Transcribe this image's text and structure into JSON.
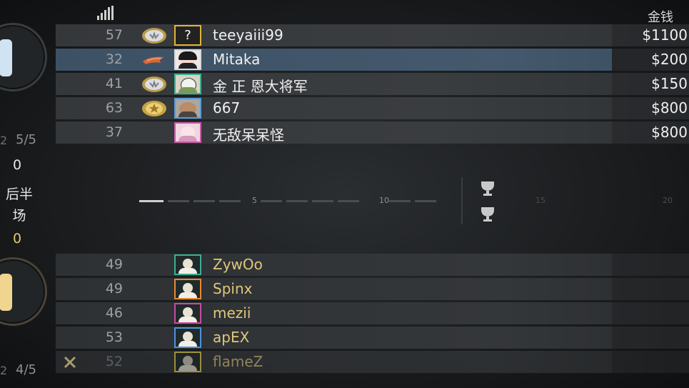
{
  "header": {
    "money_label": "金钱"
  },
  "side": {
    "t_score_ratio": "5/5",
    "t_rounds": "0",
    "half_label_1": "后半",
    "half_label_2": "场",
    "ct_rounds": "0",
    "ct_score_ratio": "4/5",
    "left_marker_top": "2",
    "left_marker_bottom": "2"
  },
  "t_team": [
    {
      "ping": "57",
      "name": "teeyaiii99",
      "money": "$1100",
      "avatar": "question-mark-avatar",
      "rank": "silver-elite-rank",
      "border": "#e0b43a"
    },
    {
      "ping": "32",
      "name": "Mitaka",
      "money": "$200",
      "avatar": "anime-girl-avatar",
      "rank": "flame-wing-rank",
      "border": "#d9d9d9"
    },
    {
      "ping": "41",
      "name": "金 正 恩大将军",
      "money": "$150",
      "avatar": "cartoon-avatar",
      "rank": "silver-elite-rank",
      "border": "#3bb08f"
    },
    {
      "ping": "63",
      "name": "667",
      "money": "$800",
      "avatar": "face-avatar",
      "rank": "gold-star-rank",
      "border": "#5b9ad8"
    },
    {
      "ping": "37",
      "name": "无敌呆呆怪",
      "money": "$800",
      "avatar": "pink-anime-avatar",
      "rank": "",
      "border": "#c85aa6"
    }
  ],
  "timeline": {
    "tick_5": "5",
    "tick_10": "10",
    "tick_15": "15",
    "tick_20": "20"
  },
  "ct_team": [
    {
      "ping": "49",
      "name": "ZywOo",
      "dead": false,
      "border": "#3bb08f"
    },
    {
      "ping": "49",
      "name": "Spinx",
      "dead": false,
      "border": "#e58a2e"
    },
    {
      "ping": "46",
      "name": "mezii",
      "dead": false,
      "border": "#c84aa0"
    },
    {
      "ping": "53",
      "name": "apEX",
      "dead": false,
      "border": "#4f90e0"
    },
    {
      "ping": "52",
      "name": "flameZ",
      "dead": true,
      "border": "#c9b740"
    }
  ],
  "colors": {
    "selected_row": "#44596d",
    "ct_name": "#e0c77a",
    "accent_gold": "#e0b43a"
  }
}
